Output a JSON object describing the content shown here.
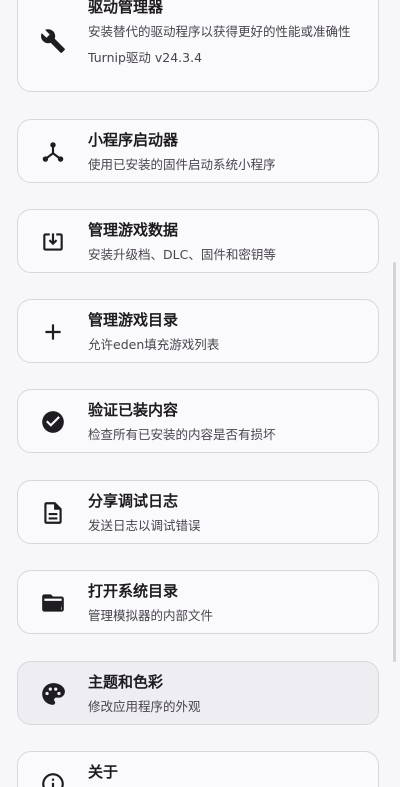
{
  "items": [
    {
      "title": "驱动管理器",
      "desc": "安装替代的驱动程序以获得更好的性能或准确性",
      "extra": "Turnip驱动  v24.3.4",
      "icon": "wrench-icon"
    },
    {
      "title": "小程序启动器",
      "desc": "使用已安装的固件启动系统小程序",
      "icon": "hub-icon"
    },
    {
      "title": "管理游戏数据",
      "desc": "安装升级档、DLC、固件和密钥等",
      "icon": "download-box-icon"
    },
    {
      "title": "管理游戏目录",
      "desc": "允许eden填充游戏列表",
      "icon": "plus-icon"
    },
    {
      "title": "验证已装内容",
      "desc": "检查所有已安装的内容是否有损坏",
      "icon": "check-circle-icon"
    },
    {
      "title": "分享调试日志",
      "desc": "发送日志以调试错误",
      "icon": "document-icon"
    },
    {
      "title": "打开系统目录",
      "desc": "管理模拟器的内部文件",
      "icon": "folder-open-icon"
    },
    {
      "title": "主题和色彩",
      "desc": "修改应用程序的外观",
      "icon": "palette-icon"
    },
    {
      "title": "关于",
      "icon": "info-icon"
    }
  ]
}
